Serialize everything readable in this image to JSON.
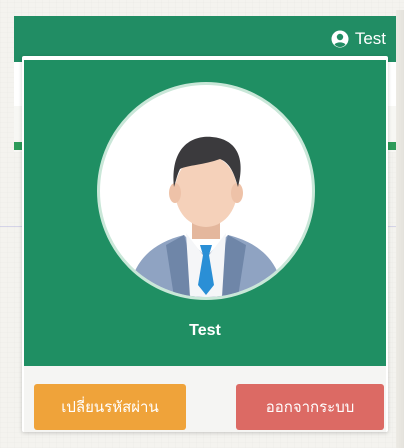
{
  "header": {
    "user_name": "Test",
    "user_icon": "user-circle-icon"
  },
  "profile": {
    "name": "Test",
    "avatar": "businessman-avatar"
  },
  "actions": {
    "change_password": "เปลี่ยนรหัสผ่าน",
    "logout": "ออกจากระบบ"
  },
  "colors": {
    "primary_green": "#1f8f63",
    "warning_orange": "#efa33a",
    "danger_red": "#dc6a64"
  }
}
